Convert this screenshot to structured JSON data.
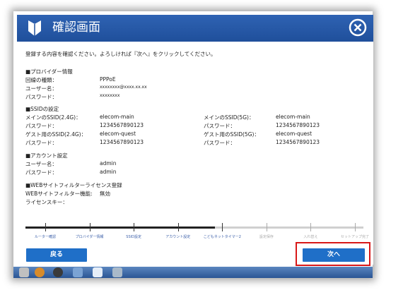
{
  "window": {
    "title": "確認画面"
  },
  "intro": "登録する内容を確認ください。よろしければ『次へ』をクリックしてください。",
  "provider": {
    "heading": "■プロバイダー情報",
    "rows": [
      {
        "label": "回線の種類：",
        "value": "PPPoE"
      },
      {
        "label": "ユーザー名：",
        "value": "xxxxxxxx@xxxx.xx.xx"
      },
      {
        "label": "パスワード：",
        "value": "xxxxxxxx"
      }
    ]
  },
  "ssid": {
    "heading": "■SSIDの設定",
    "left": [
      {
        "label": "メインのSSID(2.4G)：",
        "value": "elecom-main"
      },
      {
        "label": "パスワード：",
        "value": "1234567890123"
      },
      {
        "label": "ゲスト用のSSID(2.4G)：",
        "value": "elecom-quest"
      },
      {
        "label": "パスワード：",
        "value": "1234567890123"
      }
    ],
    "right": [
      {
        "label": "メインのSSID(5G)：",
        "value": "elecom-main"
      },
      {
        "label": "パスワード：",
        "value": "1234567890123"
      },
      {
        "label": "ゲスト用のSSID(5G)：",
        "value": "elecom-quest"
      },
      {
        "label": "パスワード：",
        "value": "1234567890123"
      }
    ]
  },
  "account": {
    "heading": "■アカウント設定",
    "rows": [
      {
        "label": "ユーザー名：",
        "value": "admin"
      },
      {
        "label": "パスワード：",
        "value": "admin"
      }
    ]
  },
  "webfilter": {
    "heading": "■WEBサイトフィルターライセンス登録",
    "rows": [
      {
        "label": "WEBサイトフィルター機能:",
        "value": "無効"
      },
      {
        "label": "ライセンスキー：",
        "value": ""
      }
    ]
  },
  "progress": {
    "completed_fraction": 0.56,
    "steps": [
      {
        "label": "ルーター確認",
        "active": true
      },
      {
        "label": "プロバイダー情報",
        "active": true
      },
      {
        "label": "SSID設定",
        "active": true
      },
      {
        "label": "アカウント設定",
        "active": true
      },
      {
        "label": "こどもネットタイマー2",
        "active": true
      },
      {
        "label": "設定保存",
        "active": false
      },
      {
        "label": "入れ替え",
        "active": false
      },
      {
        "label": "セットアップ完了",
        "active": false
      }
    ]
  },
  "buttons": {
    "back": "戻る",
    "next": "次へ"
  },
  "colors": {
    "titlebar": "#2a5aa8",
    "button": "#1f6fc8",
    "highlight": "#d81818"
  }
}
